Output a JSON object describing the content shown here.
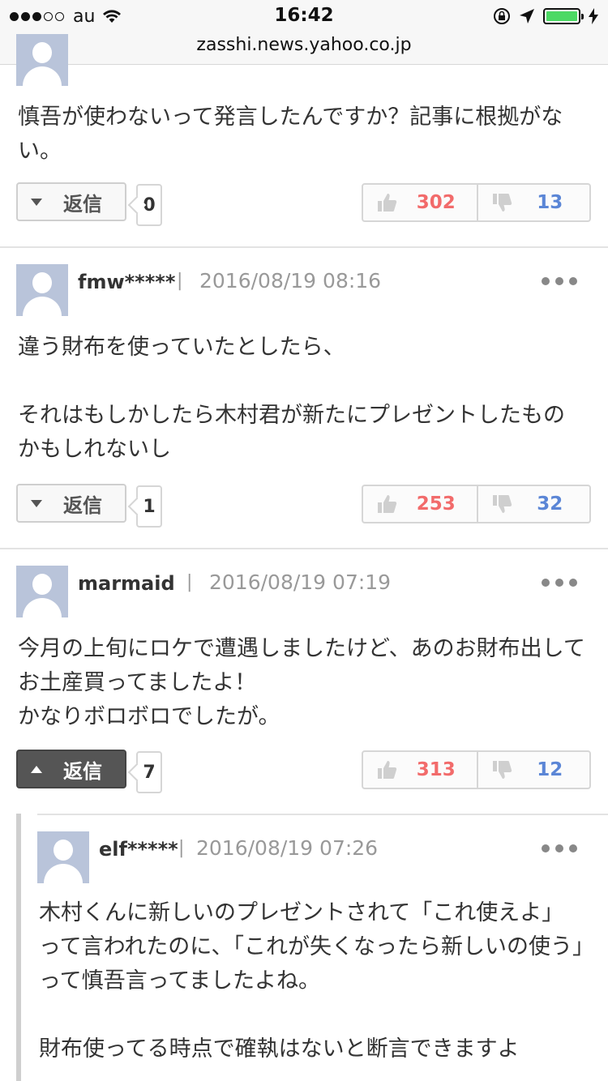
{
  "status_bar": {
    "carrier": "au",
    "time": "16:42"
  },
  "url_bar": {
    "url": "zasshi.news.yahoo.co.jp"
  },
  "comments": [
    {
      "text": "慎吾が使わないって発言したんですか？記事に根拠がない。",
      "reply_label": "返信",
      "reply_count": "0",
      "good": "302",
      "bad": "13"
    },
    {
      "user": "fmw*****",
      "separator": "|",
      "timestamp": "2016/08/19 08:16",
      "text": "違う財布を使っていたとしたら、\n\nそれはもしかしたら木村君が新たにプレゼントしたものかもしれないし",
      "reply_label": "返信",
      "reply_count": "1",
      "good": "253",
      "bad": "32"
    },
    {
      "user": "marmaid",
      "separator": "|",
      "timestamp": "2016/08/19 07:19",
      "text": "今月の上旬にロケで遭遇しましたけど、あのお財布出してお土産買ってましたよ！\nかなりボロボロでしたが。",
      "reply_label": "返信",
      "reply_count": "7",
      "good": "313",
      "bad": "12"
    }
  ],
  "reply": {
    "user": "elf*****",
    "separator": "|",
    "timestamp": "2016/08/19 07:26",
    "text": "木村くんに新しいのプレゼントされて「これ使えよ」って言われたのに、「これが失くなったら新しいの使う」って慎吾言ってましたよね。\n\n財布使ってる時点で確執はないと断言できますよ"
  },
  "icons": {
    "good": "thumbs-up-icon",
    "bad": "thumbs-down-icon",
    "more": "more-dots-icon"
  },
  "colors": {
    "good_count": "#f26b6b",
    "bad_count": "#5b86d6",
    "avatar": "#b9c4da",
    "battery": "#4cd964"
  }
}
